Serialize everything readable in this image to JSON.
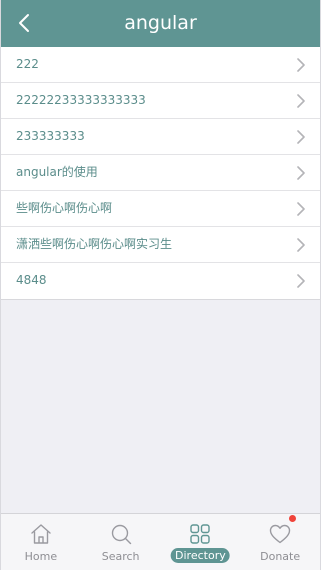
{
  "header": {
    "title": "angular"
  },
  "list": {
    "items": [
      {
        "label": "222"
      },
      {
        "label": "22222233333333333"
      },
      {
        "label": "233333333"
      },
      {
        "label": "angular的使用"
      },
      {
        "label": "些啊伤心啊伤心啊"
      },
      {
        "label": "潇洒些啊伤心啊伤心啊实习生"
      },
      {
        "label": "4848"
      }
    ]
  },
  "tabbar": {
    "tabs": [
      {
        "label": "Home",
        "icon": "home-icon"
      },
      {
        "label": "Search",
        "icon": "search-icon"
      },
      {
        "label": "Directory",
        "icon": "grid-icon"
      },
      {
        "label": "Donate",
        "icon": "heart-icon"
      }
    ],
    "active": "Directory"
  },
  "colors": {
    "brand": "#5f9593",
    "badge": "#f0433a"
  }
}
